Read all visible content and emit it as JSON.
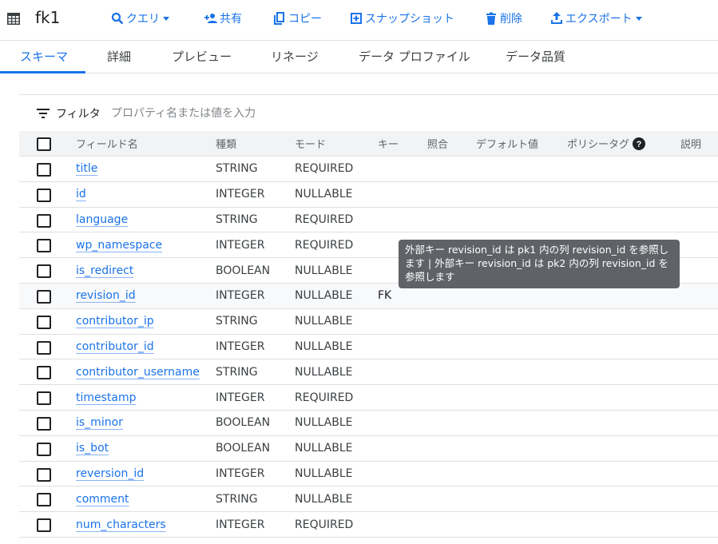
{
  "header": {
    "title": "fk1",
    "actions": [
      {
        "label": "クエリ"
      },
      {
        "label": "共有"
      },
      {
        "label": "コピー"
      },
      {
        "label": "スナップショット"
      },
      {
        "label": "削除"
      },
      {
        "label": "エクスポート"
      }
    ]
  },
  "tabs": [
    {
      "label": "スキーマ",
      "active": true
    },
    {
      "label": "詳細"
    },
    {
      "label": "プレビュー"
    },
    {
      "label": "リネージ"
    },
    {
      "label": "データ プロファイル"
    },
    {
      "label": "データ品質"
    }
  ],
  "filter": {
    "label": "フィルタ",
    "placeholder": "プロパティ名または値を入力"
  },
  "table": {
    "columns": {
      "field_name": "フィールド名",
      "type": "種類",
      "mode": "モード",
      "key": "キー",
      "collation": "照合",
      "default_value": "デフォルト値",
      "policy_tags": "ポリシータグ",
      "description": "説明"
    },
    "rows": [
      {
        "name": "title",
        "type": "STRING",
        "mode": "REQUIRED",
        "key": ""
      },
      {
        "name": "id",
        "type": "INTEGER",
        "mode": "NULLABLE",
        "key": ""
      },
      {
        "name": "language",
        "type": "STRING",
        "mode": "REQUIRED",
        "key": ""
      },
      {
        "name": "wp_namespace",
        "type": "INTEGER",
        "mode": "REQUIRED",
        "key": ""
      },
      {
        "name": "is_redirect",
        "type": "BOOLEAN",
        "mode": "NULLABLE",
        "key": ""
      },
      {
        "name": "revision_id",
        "type": "INTEGER",
        "mode": "NULLABLE",
        "key": "FK"
      },
      {
        "name": "contributor_ip",
        "type": "STRING",
        "mode": "NULLABLE",
        "key": ""
      },
      {
        "name": "contributor_id",
        "type": "INTEGER",
        "mode": "NULLABLE",
        "key": ""
      },
      {
        "name": "contributor_username",
        "type": "STRING",
        "mode": "NULLABLE",
        "key": ""
      },
      {
        "name": "timestamp",
        "type": "INTEGER",
        "mode": "REQUIRED",
        "key": ""
      },
      {
        "name": "is_minor",
        "type": "BOOLEAN",
        "mode": "NULLABLE",
        "key": ""
      },
      {
        "name": "is_bot",
        "type": "BOOLEAN",
        "mode": "NULLABLE",
        "key": ""
      },
      {
        "name": "reversion_id",
        "type": "INTEGER",
        "mode": "NULLABLE",
        "key": ""
      },
      {
        "name": "comment",
        "type": "STRING",
        "mode": "NULLABLE",
        "key": ""
      },
      {
        "name": "num_characters",
        "type": "INTEGER",
        "mode": "REQUIRED",
        "key": ""
      }
    ]
  },
  "tooltip": {
    "text": "外部キー revision_id は pk1 内の列 revision_id を参照します | 外部キー revision_id は pk2 内の列 revision_id を参照します"
  },
  "colors": {
    "accent": "#1a73e8",
    "tooltip_bg": "#5f6368"
  }
}
